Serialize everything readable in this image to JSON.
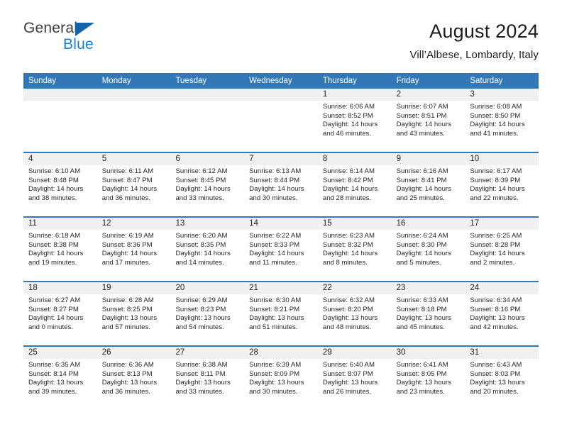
{
  "brand": {
    "name_part1": "General",
    "name_part2": "Blue"
  },
  "header": {
    "title": "August 2024",
    "subtitle": "Vill’Albese, Lombardy, Italy"
  },
  "colors": {
    "header_blue": "#3277b6",
    "brand_blue": "#1a7fd4",
    "daynum_band": "#f0f0f0"
  },
  "weekdays": [
    "Sunday",
    "Monday",
    "Tuesday",
    "Wednesday",
    "Thursday",
    "Friday",
    "Saturday"
  ],
  "weeks": [
    [
      {
        "day": "",
        "lines": []
      },
      {
        "day": "",
        "lines": []
      },
      {
        "day": "",
        "lines": []
      },
      {
        "day": "",
        "lines": []
      },
      {
        "day": "1",
        "lines": [
          "Sunrise: 6:06 AM",
          "Sunset: 8:52 PM",
          "Daylight: 14 hours",
          "and 46 minutes."
        ]
      },
      {
        "day": "2",
        "lines": [
          "Sunrise: 6:07 AM",
          "Sunset: 8:51 PM",
          "Daylight: 14 hours",
          "and 43 minutes."
        ]
      },
      {
        "day": "3",
        "lines": [
          "Sunrise: 6:08 AM",
          "Sunset: 8:50 PM",
          "Daylight: 14 hours",
          "and 41 minutes."
        ]
      }
    ],
    [
      {
        "day": "4",
        "lines": [
          "Sunrise: 6:10 AM",
          "Sunset: 8:48 PM",
          "Daylight: 14 hours",
          "and 38 minutes."
        ]
      },
      {
        "day": "5",
        "lines": [
          "Sunrise: 6:11 AM",
          "Sunset: 8:47 PM",
          "Daylight: 14 hours",
          "and 36 minutes."
        ]
      },
      {
        "day": "6",
        "lines": [
          "Sunrise: 6:12 AM",
          "Sunset: 8:45 PM",
          "Daylight: 14 hours",
          "and 33 minutes."
        ]
      },
      {
        "day": "7",
        "lines": [
          "Sunrise: 6:13 AM",
          "Sunset: 8:44 PM",
          "Daylight: 14 hours",
          "and 30 minutes."
        ]
      },
      {
        "day": "8",
        "lines": [
          "Sunrise: 6:14 AM",
          "Sunset: 8:42 PM",
          "Daylight: 14 hours",
          "and 28 minutes."
        ]
      },
      {
        "day": "9",
        "lines": [
          "Sunrise: 6:16 AM",
          "Sunset: 8:41 PM",
          "Daylight: 14 hours",
          "and 25 minutes."
        ]
      },
      {
        "day": "10",
        "lines": [
          "Sunrise: 6:17 AM",
          "Sunset: 8:39 PM",
          "Daylight: 14 hours",
          "and 22 minutes."
        ]
      }
    ],
    [
      {
        "day": "11",
        "lines": [
          "Sunrise: 6:18 AM",
          "Sunset: 8:38 PM",
          "Daylight: 14 hours",
          "and 19 minutes."
        ]
      },
      {
        "day": "12",
        "lines": [
          "Sunrise: 6:19 AM",
          "Sunset: 8:36 PM",
          "Daylight: 14 hours",
          "and 17 minutes."
        ]
      },
      {
        "day": "13",
        "lines": [
          "Sunrise: 6:20 AM",
          "Sunset: 8:35 PM",
          "Daylight: 14 hours",
          "and 14 minutes."
        ]
      },
      {
        "day": "14",
        "lines": [
          "Sunrise: 6:22 AM",
          "Sunset: 8:33 PM",
          "Daylight: 14 hours",
          "and 11 minutes."
        ]
      },
      {
        "day": "15",
        "lines": [
          "Sunrise: 6:23 AM",
          "Sunset: 8:32 PM",
          "Daylight: 14 hours",
          "and 8 minutes."
        ]
      },
      {
        "day": "16",
        "lines": [
          "Sunrise: 6:24 AM",
          "Sunset: 8:30 PM",
          "Daylight: 14 hours",
          "and 5 minutes."
        ]
      },
      {
        "day": "17",
        "lines": [
          "Sunrise: 6:25 AM",
          "Sunset: 8:28 PM",
          "Daylight: 14 hours",
          "and 2 minutes."
        ]
      }
    ],
    [
      {
        "day": "18",
        "lines": [
          "Sunrise: 6:27 AM",
          "Sunset: 8:27 PM",
          "Daylight: 14 hours",
          "and 0 minutes."
        ]
      },
      {
        "day": "19",
        "lines": [
          "Sunrise: 6:28 AM",
          "Sunset: 8:25 PM",
          "Daylight: 13 hours",
          "and 57 minutes."
        ]
      },
      {
        "day": "20",
        "lines": [
          "Sunrise: 6:29 AM",
          "Sunset: 8:23 PM",
          "Daylight: 13 hours",
          "and 54 minutes."
        ]
      },
      {
        "day": "21",
        "lines": [
          "Sunrise: 6:30 AM",
          "Sunset: 8:21 PM",
          "Daylight: 13 hours",
          "and 51 minutes."
        ]
      },
      {
        "day": "22",
        "lines": [
          "Sunrise: 6:32 AM",
          "Sunset: 8:20 PM",
          "Daylight: 13 hours",
          "and 48 minutes."
        ]
      },
      {
        "day": "23",
        "lines": [
          "Sunrise: 6:33 AM",
          "Sunset: 8:18 PM",
          "Daylight: 13 hours",
          "and 45 minutes."
        ]
      },
      {
        "day": "24",
        "lines": [
          "Sunrise: 6:34 AM",
          "Sunset: 8:16 PM",
          "Daylight: 13 hours",
          "and 42 minutes."
        ]
      }
    ],
    [
      {
        "day": "25",
        "lines": [
          "Sunrise: 6:35 AM",
          "Sunset: 8:14 PM",
          "Daylight: 13 hours",
          "and 39 minutes."
        ]
      },
      {
        "day": "26",
        "lines": [
          "Sunrise: 6:36 AM",
          "Sunset: 8:13 PM",
          "Daylight: 13 hours",
          "and 36 minutes."
        ]
      },
      {
        "day": "27",
        "lines": [
          "Sunrise: 6:38 AM",
          "Sunset: 8:11 PM",
          "Daylight: 13 hours",
          "and 33 minutes."
        ]
      },
      {
        "day": "28",
        "lines": [
          "Sunrise: 6:39 AM",
          "Sunset: 8:09 PM",
          "Daylight: 13 hours",
          "and 30 minutes."
        ]
      },
      {
        "day": "29",
        "lines": [
          "Sunrise: 6:40 AM",
          "Sunset: 8:07 PM",
          "Daylight: 13 hours",
          "and 26 minutes."
        ]
      },
      {
        "day": "30",
        "lines": [
          "Sunrise: 6:41 AM",
          "Sunset: 8:05 PM",
          "Daylight: 13 hours",
          "and 23 minutes."
        ]
      },
      {
        "day": "31",
        "lines": [
          "Sunrise: 6:43 AM",
          "Sunset: 8:03 PM",
          "Daylight: 13 hours",
          "and 20 minutes."
        ]
      }
    ]
  ]
}
